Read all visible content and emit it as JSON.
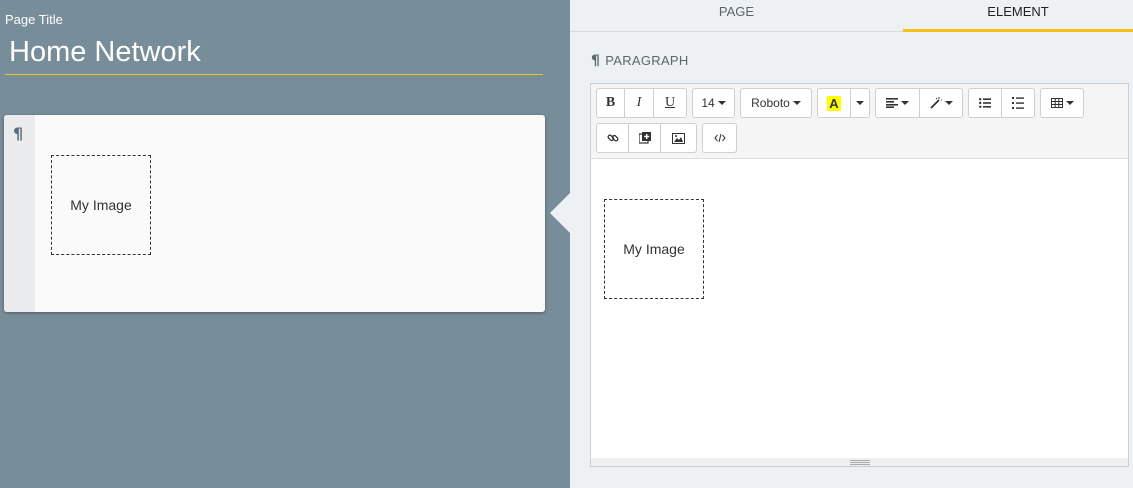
{
  "left": {
    "page_title_label": "Page Title",
    "page_title_value": "Home Network",
    "card": {
      "paragraph_icon": "¶",
      "image_placeholder": "My Image"
    }
  },
  "right": {
    "tabs": [
      {
        "label": "PAGE"
      },
      {
        "label": "ELEMENT"
      }
    ],
    "section_icon": "¶",
    "section_label": "PARAGRAPH",
    "toolbar": {
      "bold": "B",
      "italic": "I",
      "underline": "U",
      "font_size": "14",
      "font_family": "Roboto",
      "highlight": "A"
    },
    "editor_content": {
      "image_placeholder": "My Image"
    }
  },
  "colors": {
    "left_background": "#788d9a",
    "right_background": "#edf1f3",
    "accent": "#f5c316",
    "highlight": "#ffff00"
  }
}
